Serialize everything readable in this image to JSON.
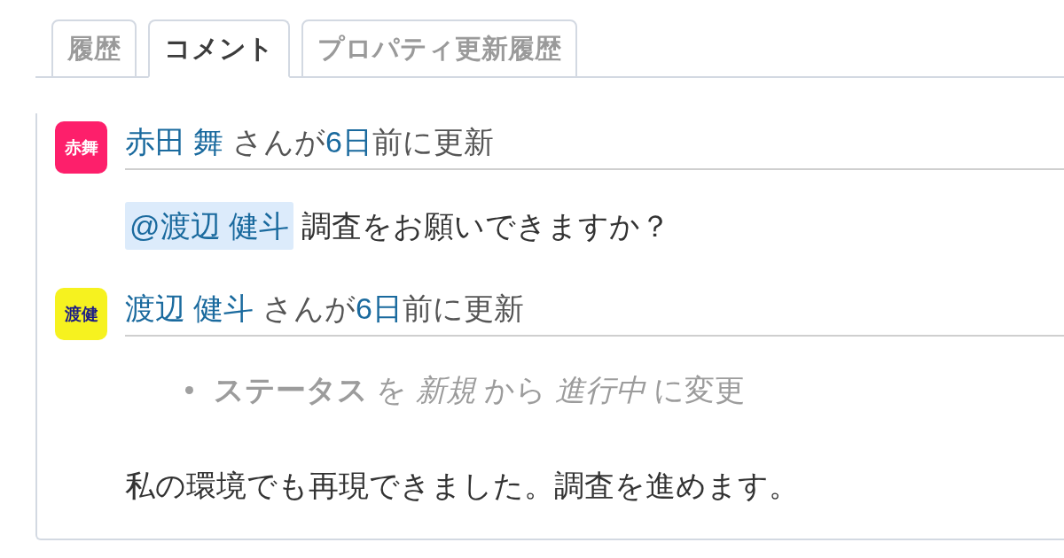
{
  "tabs": [
    {
      "label": "履歴",
      "selected": false
    },
    {
      "label": "コメント",
      "selected": true
    },
    {
      "label": "プロパティ更新履歴",
      "selected": false
    }
  ],
  "journals": [
    {
      "avatar": {
        "initials": "赤舞",
        "color": "#fd1f6b"
      },
      "author": "赤田 舞",
      "author_suffix": "さんが",
      "age": "6日",
      "age_suffix": "前に更新",
      "notes": {
        "mention": "@渡辺 健斗",
        "text": "調査をお願いできますか？"
      }
    },
    {
      "avatar": {
        "initials": "渡健",
        "color": "#f6f21f"
      },
      "author": "渡辺 健斗",
      "author_suffix": "さんが",
      "age": "6日",
      "age_suffix": "前に更新",
      "details": [
        "**ステータス** を *新規* から *進行中* に変更"
      ],
      "notes": {
        "text": "私の環境でも再現できました。調査を進めます。"
      }
    }
  ]
}
